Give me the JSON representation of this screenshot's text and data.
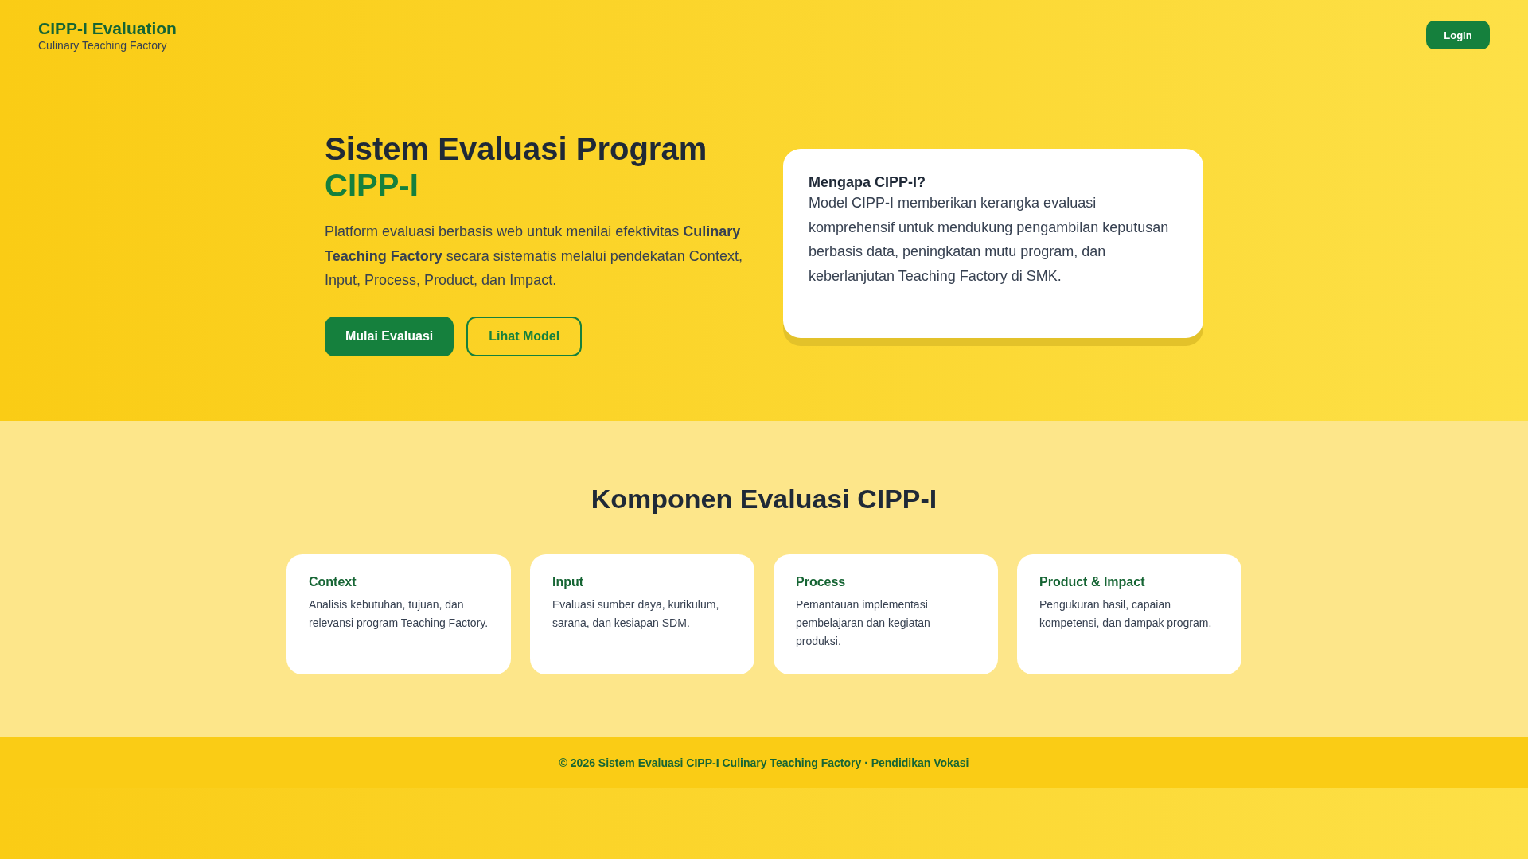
{
  "header": {
    "brand_title": "CIPP-I Evaluation",
    "brand_subtitle": "Culinary Teaching Factory",
    "login_button": "Login"
  },
  "hero": {
    "title": "Sistem Evaluasi Program",
    "title_highlight": "CIPP-I",
    "description": "Platform evaluasi berbasis web untuk menilai efektivitas **Culinary Teaching Factory** secara sistematis melalui pendekatan Context, Input, Process, Product, dan Impact.",
    "buttons": [
      {
        "label": "Mulai Evaluasi",
        "kind": "primary"
      },
      {
        "label": "Lihat Model",
        "kind": "outline"
      }
    ],
    "info_card": {
      "title": "Mengapa CIPP-I?",
      "text": "Model CIPP-I memberikan kerangka evaluasi komprehensif untuk mendukung pengambilan keputusan berbasis data, peningkatan mutu program, dan keberlanjutan Teaching Factory di SMK."
    }
  },
  "components": {
    "heading": "Komponen Evaluasi CIPP-I",
    "cards": [
      {
        "title": "Context",
        "text": "Analisis kebutuhan, tujuan, dan relevansi program Teaching Factory."
      },
      {
        "title": "Input",
        "text": "Evaluasi sumber daya, kurikulum, sarana, dan kesiapan SDM."
      },
      {
        "title": "Process",
        "text": "Pemantauan implementasi pembelajaran dan kegiatan produksi."
      },
      {
        "title": "Product & Impact",
        "text": "Pengukuran hasil, capaian kompetensi, dan dampak program."
      }
    ]
  },
  "footer": {
    "text": "© 2026 Sistem Evaluasi CIPP-I Culinary Teaching Factory · Pendidikan Vokasi"
  }
}
